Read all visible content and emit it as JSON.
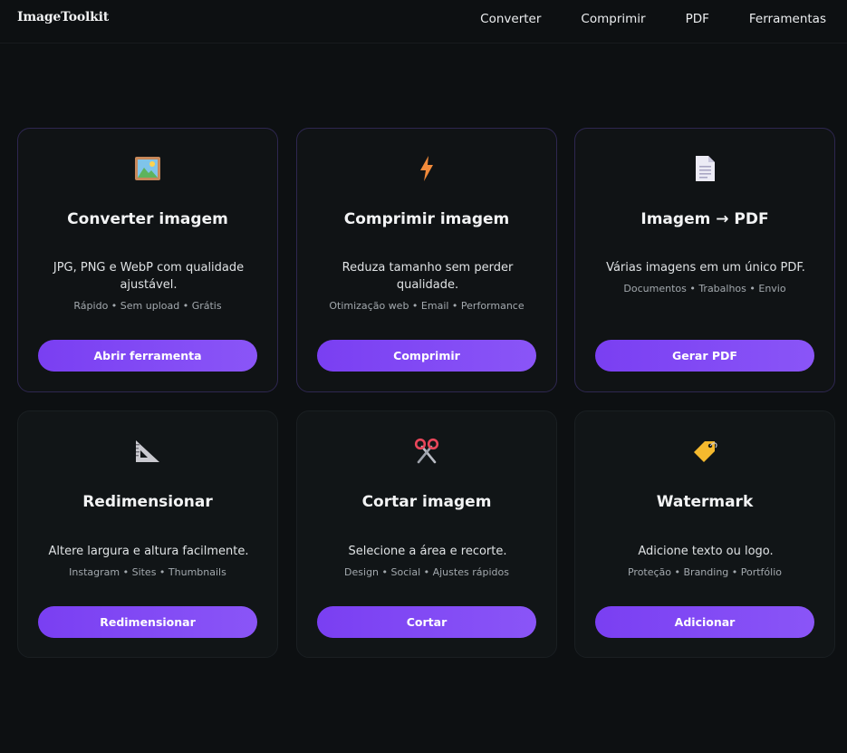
{
  "header": {
    "brand": "ImageToolkit",
    "nav": [
      "Converter",
      "Comprimir",
      "PDF",
      "Ferramentas"
    ]
  },
  "cards": [
    {
      "icon": "framed-picture-icon",
      "title": "Converter imagem",
      "description": "JPG, PNG e WebP com qualidade ajustável.",
      "tags": "Rápido • Sem upload • Grátis",
      "button": "Abrir ferramenta"
    },
    {
      "icon": "lightning-icon",
      "title": "Comprimir imagem",
      "description": "Reduza tamanho sem perder qualidade.",
      "tags": "Otimização web • Email • Performance",
      "button": "Comprimir"
    },
    {
      "icon": "document-icon",
      "title": "Imagem → PDF",
      "description": "Várias imagens em um único PDF.",
      "tags": "Documentos • Trabalhos • Envio",
      "button": "Gerar PDF"
    },
    {
      "icon": "triangle-ruler-icon",
      "title": "Redimensionar",
      "description": "Altere largura e altura facilmente.",
      "tags": "Instagram • Sites • Thumbnails",
      "button": "Redimensionar"
    },
    {
      "icon": "scissors-icon",
      "title": "Cortar imagem",
      "description": "Selecione a área e recorte.",
      "tags": "Design • Social • Ajustes rápidos",
      "button": "Cortar"
    },
    {
      "icon": "label-tag-icon",
      "title": "Watermark",
      "description": "Adicione texto ou logo.",
      "tags": "Proteção • Branding • Portfólio",
      "button": "Adicionar"
    }
  ],
  "colors": {
    "background": "#0d1012",
    "card": "#111517",
    "accent": "#7a3ff2",
    "accent_end": "#8a55f7"
  }
}
